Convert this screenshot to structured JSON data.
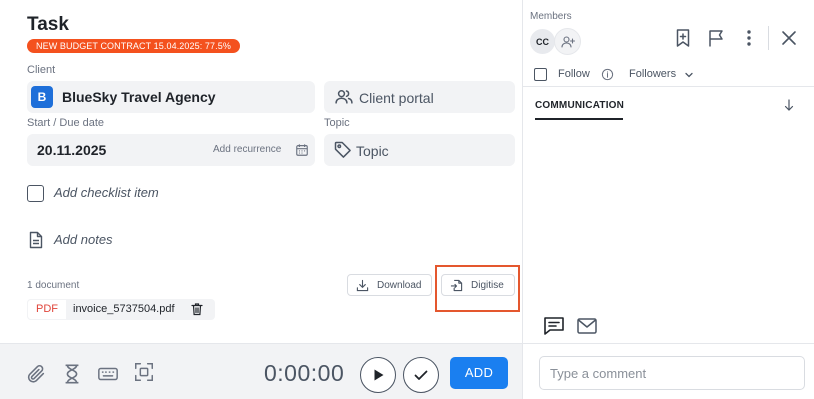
{
  "task": {
    "title": "Task",
    "badge": "NEW BUDGET CONTRACT 15.04.2025: 77.5%",
    "client_label": "Client",
    "client_initial": "B",
    "client_name": "BlueSky Travel Agency",
    "client_portal": "Client portal",
    "date_label": "Start / Due date",
    "date_value": "20.11.2025",
    "add_recurrence": "Add recurrence",
    "topic_label": "Topic",
    "topic_placeholder": "Topic",
    "checklist_placeholder": "Add checklist item",
    "notes_placeholder": "Add notes"
  },
  "documents": {
    "count_label": "1 document",
    "download_label": "Download",
    "digitise_label": "Digitise",
    "file_type": "PDF",
    "file_name": "invoice_5737504.pdf"
  },
  "footer": {
    "timer": "0:00:00",
    "add_label": "ADD"
  },
  "sidebar": {
    "members_label": "Members",
    "member_initials": "CC",
    "follow_label": "Follow",
    "followers_label": "Followers",
    "tab_communication": "COMMUNICATION",
    "comment_placeholder": "Type a comment"
  },
  "colors": {
    "badge": "#f4511e",
    "primary": "#1a7ff0",
    "highlight": "#e4572e",
    "client_avatar": "#1e6fd9",
    "pdf": "#e0443a"
  }
}
